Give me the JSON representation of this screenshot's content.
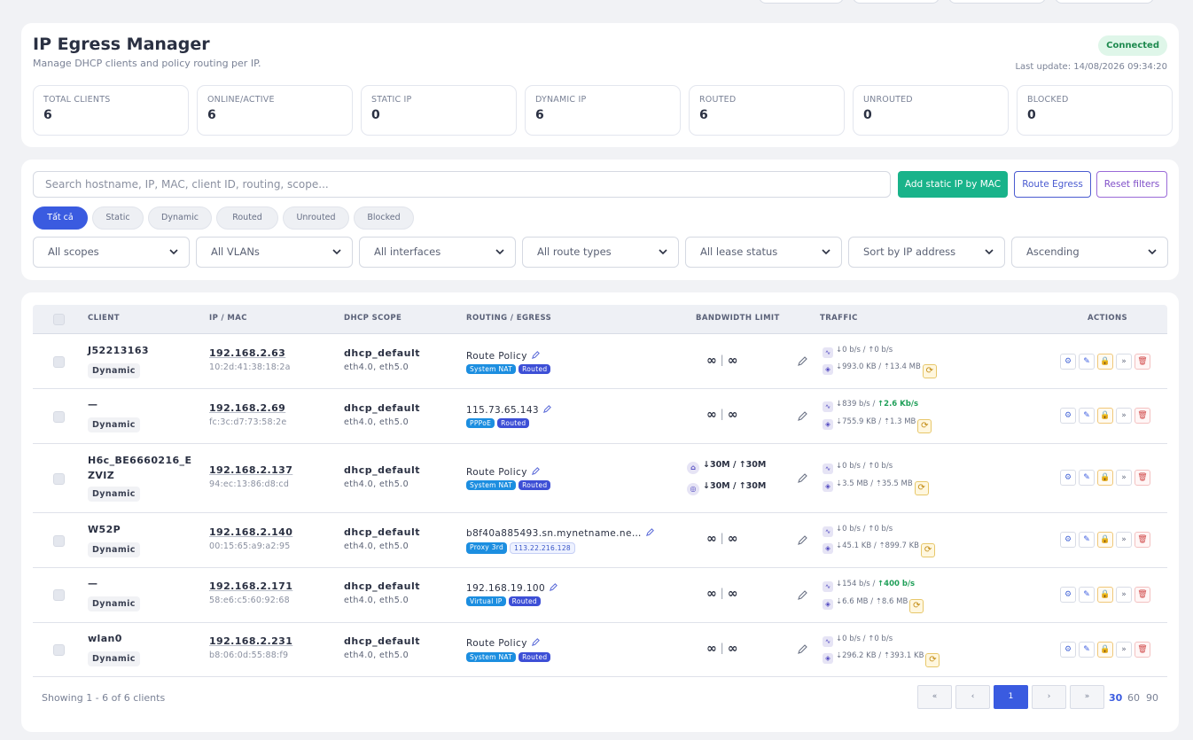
{
  "header": {
    "title": "IP Egress Manager",
    "subtitle": "Manage DHCP clients and policy routing per IP.",
    "status": "Connected",
    "last_update": "Last update: 14/08/2026 09:34:20"
  },
  "stats": [
    {
      "label": "TOTAL CLIENTS",
      "value": "6"
    },
    {
      "label": "ONLINE/ACTIVE",
      "value": "6"
    },
    {
      "label": "STATIC IP",
      "value": "0"
    },
    {
      "label": "DYNAMIC IP",
      "value": "6"
    },
    {
      "label": "ROUTED",
      "value": "6"
    },
    {
      "label": "UNROUTED",
      "value": "0"
    },
    {
      "label": "BLOCKED",
      "value": "0"
    }
  ],
  "filters": {
    "search_placeholder": "Search hostname, IP, MAC, client ID, routing, scope...",
    "add_static": "Add static IP by MAC",
    "route_egress": "Route Egress",
    "reset": "Reset filters",
    "chips": [
      "Tất cả",
      "Static",
      "Dynamic",
      "Routed",
      "Unrouted",
      "Blocked"
    ],
    "selects": [
      "All scopes",
      "All VLANs",
      "All interfaces",
      "All route types",
      "All lease status",
      "Sort by IP address",
      "Ascending"
    ]
  },
  "table": {
    "headers": [
      "CLIENT",
      "IP / MAC",
      "DHCP SCOPE",
      "ROUTING / EGRESS",
      "BANDWIDTH LIMIT",
      "TRAFFIC",
      "ACTIONS"
    ],
    "rows": [
      {
        "name": "J52213163",
        "type": "Dynamic",
        "ip": "192.168.2.63",
        "mac": "10:2d:41:38:18:2a",
        "scope": "dhcp_default",
        "ifaces": "eth4.0, eth5.0",
        "route": "Route Policy",
        "tag1": "System NAT",
        "tag2": "Routed",
        "bw_down": "∞",
        "bw_up": "∞",
        "rx_rate": "↓0 b/s",
        "tx_rate": "↑0 b/s",
        "rx_total": "⇣993.0 KB",
        "tx_total": "⇡13.4 MB"
      },
      {
        "name": "—",
        "type": "Dynamic",
        "ip": "192.168.2.69",
        "mac": "fc:3c:d7:73:58:2e",
        "scope": "dhcp_default",
        "ifaces": "eth4.0, eth5.0",
        "route": "115.73.65.143",
        "tag1": "PPPoE",
        "tag2": "Routed",
        "bw_down": "∞",
        "bw_up": "∞",
        "rx_rate": "↓839 b/s",
        "tx_rate": "↑2.6 Kb/s",
        "rx_total": "⇣755.9 KB",
        "tx_total": "⇡1.3 MB"
      },
      {
        "name": "H6c_BE6660216_EZVIZ",
        "type": "Dynamic",
        "ip": "192.168.2.137",
        "mac": "94:ec:13:86:d8:cd",
        "scope": "dhcp_default",
        "ifaces": "eth4.0, eth5.0",
        "route": "Route Policy",
        "tag1": "System NAT",
        "tag2": "Routed",
        "bw_lan": "↓30M / ↑30M",
        "bw_wan": "↓30M / ↑30M",
        "rx_rate": "↓0 b/s",
        "tx_rate": "↑0 b/s",
        "rx_total": "⇣3.5 MB",
        "tx_total": "⇡35.5 MB"
      },
      {
        "name": "W52P",
        "type": "Dynamic",
        "ip": "192.168.2.140",
        "mac": "00:15:65:a9:a2:95",
        "scope": "dhcp_default",
        "ifaces": "eth4.0, eth5.0",
        "route": "b8f40a885493.sn.mynetname.ne…",
        "tag1": "Proxy 3rd",
        "tag2": "113.22.216.128",
        "bw_down": "∞",
        "bw_up": "∞",
        "rx_rate": "↓0 b/s",
        "tx_rate": "↑0 b/s",
        "rx_total": "⇣45.1 KB",
        "tx_total": "⇡899.7 KB"
      },
      {
        "name": "—",
        "type": "Dynamic",
        "ip": "192.168.2.171",
        "mac": "58:e6:c5:60:92:68",
        "scope": "dhcp_default",
        "ifaces": "eth4.0, eth5.0",
        "route": "192.168.19.100",
        "tag1": "Virtual IP",
        "tag2": "Routed",
        "bw_down": "∞",
        "bw_up": "∞",
        "rx_rate": "↓154 b/s",
        "tx_rate": "↑400 b/s",
        "rx_total": "⇣6.6 MB",
        "tx_total": "⇡8.6 MB"
      },
      {
        "name": "wlan0",
        "type": "Dynamic",
        "ip": "192.168.2.231",
        "mac": "b8:06:0d:55:88:f9",
        "scope": "dhcp_default",
        "ifaces": "eth4.0, eth5.0",
        "route": "Route Policy",
        "tag1": "System NAT",
        "tag2": "Routed",
        "bw_down": "∞",
        "bw_up": "∞",
        "rx_rate": "↓0 b/s",
        "tx_rate": "↑0 b/s",
        "rx_total": "⇣296.2 KB",
        "tx_total": "⇡393.1 KB"
      }
    ],
    "bw_sep": "|",
    "rate_sep": "/"
  },
  "pagination": {
    "showing": "Showing 1 - 6 of 6 clients",
    "first": "«",
    "prev": "‹",
    "current": "1",
    "next": "›",
    "last": "»",
    "sizes": [
      "30",
      "60",
      "90"
    ]
  }
}
